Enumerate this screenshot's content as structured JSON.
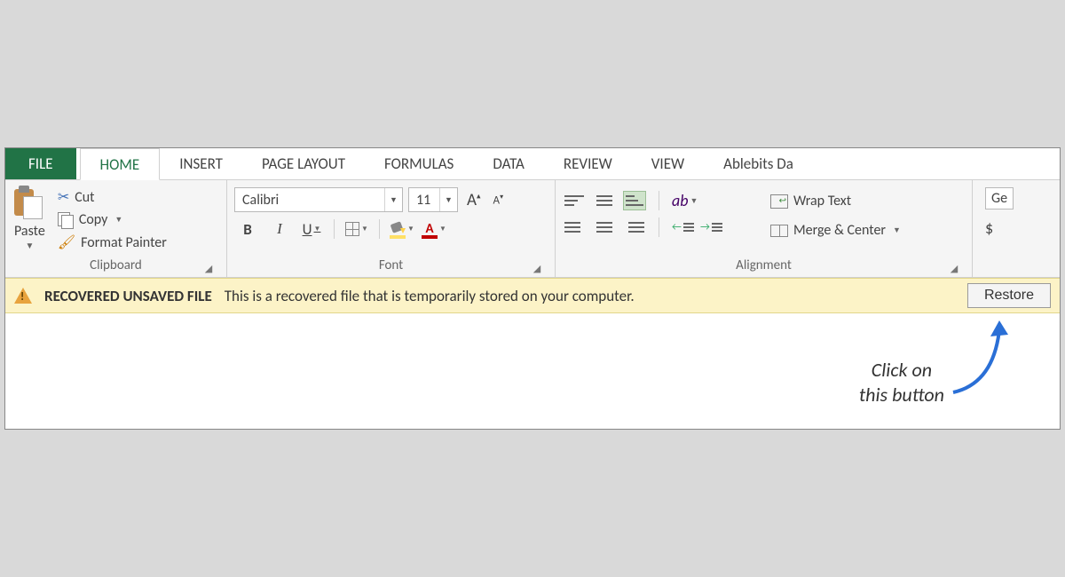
{
  "tabs": {
    "file": "FILE",
    "home": "HOME",
    "insert": "INSERT",
    "page_layout": "PAGE LAYOUT",
    "formulas": "FORMULAS",
    "data": "DATA",
    "review": "REVIEW",
    "view": "VIEW",
    "ablebits": "Ablebits Da"
  },
  "clipboard": {
    "paste": "Paste",
    "cut": "Cut",
    "copy": "Copy",
    "format_painter": "Format Painter",
    "group_label": "Clipboard"
  },
  "font": {
    "name": "Calibri",
    "size": "11",
    "bold": "B",
    "italic": "I",
    "underline": "U",
    "grow": "A",
    "shrink": "A",
    "color_letter": "A",
    "group_label": "Font"
  },
  "alignment": {
    "wrap_text": "Wrap Text",
    "merge_center": "Merge & Center",
    "group_label": "Alignment"
  },
  "extra": {
    "top": "Ge",
    "bottom": "$"
  },
  "notice": {
    "title": "RECOVERED UNSAVED FILE",
    "text": "This is a recovered file that is temporarily stored on your computer.",
    "restore": "Restore"
  },
  "annotation": {
    "line1": "Click on",
    "line2": "this button"
  }
}
